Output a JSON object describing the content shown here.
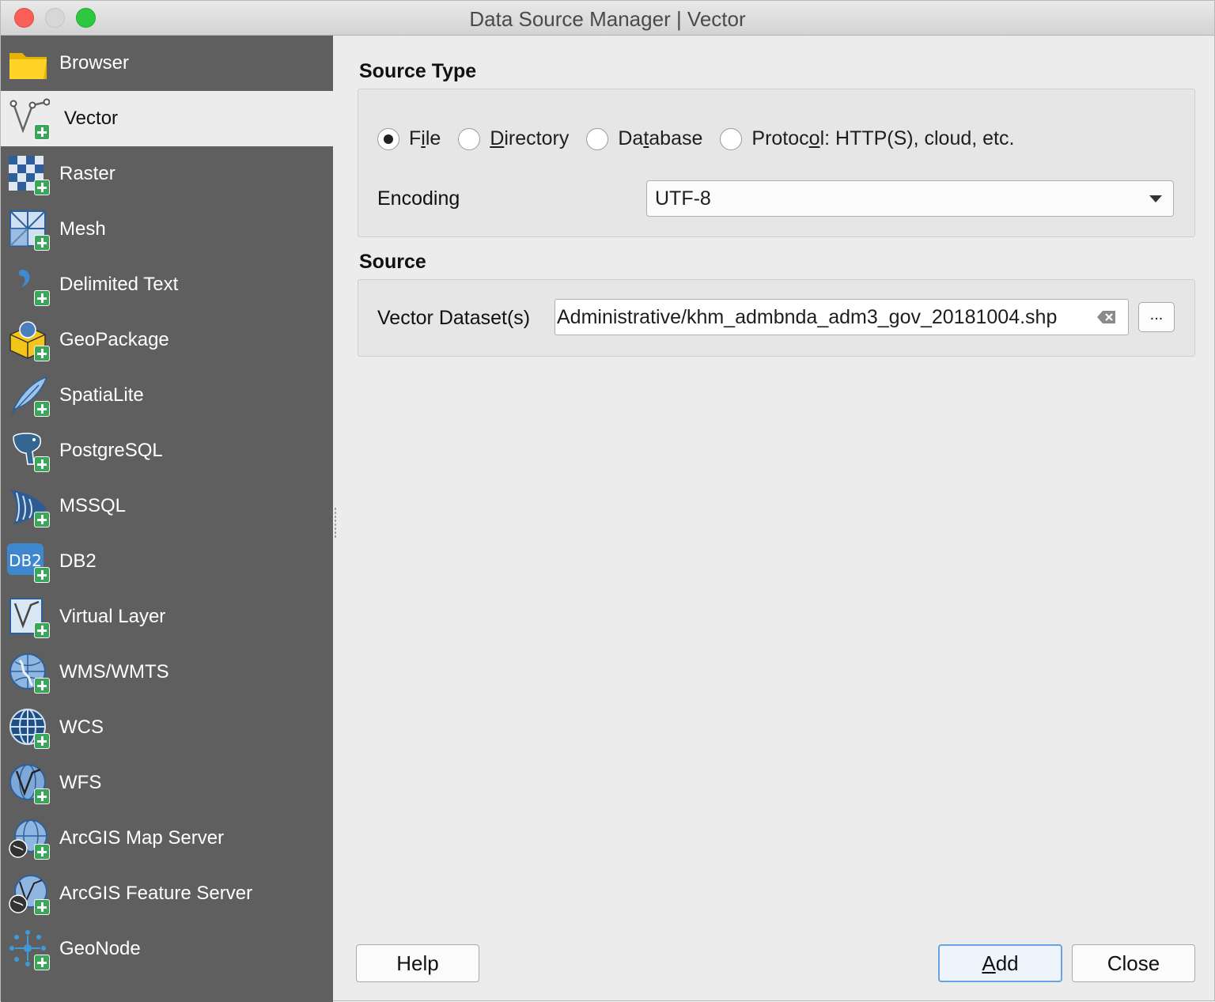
{
  "window": {
    "title": "Data Source Manager | Vector"
  },
  "sidebar": {
    "items": [
      {
        "label": "Browser",
        "icon": "folder-icon"
      },
      {
        "label": "Vector",
        "icon": "vector-icon",
        "active": true
      },
      {
        "label": "Raster",
        "icon": "raster-icon"
      },
      {
        "label": "Mesh",
        "icon": "mesh-icon"
      },
      {
        "label": "Delimited Text",
        "icon": "delimited-text-icon"
      },
      {
        "label": "GeoPackage",
        "icon": "geopackage-icon"
      },
      {
        "label": "SpatiaLite",
        "icon": "spatialite-feather-icon"
      },
      {
        "label": "PostgreSQL",
        "icon": "postgresql-elephant-icon"
      },
      {
        "label": "MSSQL",
        "icon": "mssql-icon"
      },
      {
        "label": "DB2",
        "icon": "db2-icon"
      },
      {
        "label": "Virtual Layer",
        "icon": "virtual-layer-icon"
      },
      {
        "label": "WMS/WMTS",
        "icon": "wms-globe-icon"
      },
      {
        "label": "WCS",
        "icon": "wcs-globe-icon"
      },
      {
        "label": "WFS",
        "icon": "wfs-globe-icon"
      },
      {
        "label": "ArcGIS Map Server",
        "icon": "arcgis-map-server-icon"
      },
      {
        "label": "ArcGIS Feature Server",
        "icon": "arcgis-feature-server-icon"
      },
      {
        "label": "GeoNode",
        "icon": "geonode-icon"
      }
    ]
  },
  "source_type": {
    "title": "Source Type",
    "options": {
      "file": {
        "pre": "F",
        "u": "i",
        "post": "le",
        "checked": true
      },
      "directory": {
        "pre": "",
        "u": "D",
        "post": "irectory"
      },
      "database": {
        "pre": "Da",
        "u": "t",
        "post": "abase"
      },
      "protocol": {
        "pre": "Protoc",
        "u": "o",
        "post": "l: HTTP(S), cloud, etc."
      }
    },
    "encoding_label": "Encoding",
    "encoding_value": "UTF-8"
  },
  "source": {
    "title": "Source",
    "dataset_label": "Vector Dataset(s)",
    "dataset_value": "Administrative/khm_admbnda_adm3_gov_20181004.shp",
    "browse_label": "..."
  },
  "buttons": {
    "help": "Help",
    "add": {
      "u": "A",
      "post": "dd"
    },
    "close": "Close"
  },
  "colors": {
    "sidebar_bg": "#5f5f5f",
    "accent_plus": "#3ba55a",
    "primary_border": "#6aa3df"
  }
}
